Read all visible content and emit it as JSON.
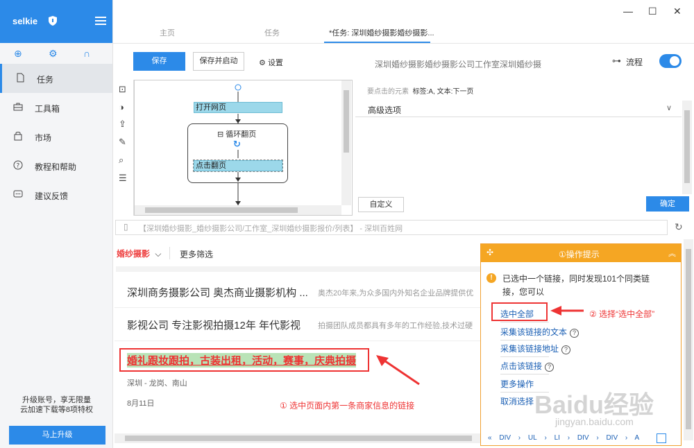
{
  "sidebar": {
    "logo": "selkie",
    "items": [
      {
        "label": "任务",
        "icon": "document-icon"
      },
      {
        "label": "工具箱",
        "icon": "toolbox-icon"
      },
      {
        "label": "市场",
        "icon": "bag-icon"
      },
      {
        "label": "教程和帮助",
        "icon": "help-icon"
      },
      {
        "label": "建议反馈",
        "icon": "feedback-icon"
      }
    ],
    "upgrade_line1": "升级账号，享无限量",
    "upgrade_line2": "云加速下载等8项特权",
    "upgrade_button": "马上升级"
  },
  "tabs": [
    {
      "label": "主页"
    },
    {
      "label": "任务"
    },
    {
      "label": "*任务: 深圳婚纱摄影婚纱摄影..."
    }
  ],
  "toolbar": {
    "save": "保存",
    "save_and_run": "保存并启动",
    "settings": "设置",
    "task_title": "深圳婚纱摄影婚纱摄影公司工作室深圳婚纱摄",
    "flow_label": "流程"
  },
  "workflow": {
    "node_open": "打开网页",
    "loop_title": "循环翻页",
    "node_click": "点击翻页"
  },
  "right_panel": {
    "hint_label": "要点击的元素",
    "hint_value": "标签:A, 文本:下一页",
    "advanced": "高级选项",
    "custom": "自定义",
    "ok": "确定"
  },
  "url": "【深圳婚纱摄影_婚纱摄影公司/工作室_深圳婚纱摄影报价/列表】 - 深圳百姓网",
  "browser": {
    "filter_category": "婚纱摄影",
    "filter_more": "更多筛选",
    "rows": [
      {
        "title": "深圳商务摄影公司 奥杰商业摄影机构 ...",
        "desc": "奥杰20年来,为众多国内外知名企业品牌提供优"
      },
      {
        "title": "影视公司 专注影视拍摄12年 年代影视",
        "desc": "拍摄团队成员都具有多年的工作经验,技术过硬"
      }
    ],
    "highlight_title": "婚礼跟妆跟拍，古装出租，活动，赛事，庆典拍摄",
    "location": "深圳 - 龙岗、南山",
    "date": "8月11日",
    "note": "① 选中页面内第一条商家信息的链接"
  },
  "popup": {
    "title": "①操作提示",
    "message": "已选中一个链接，同时发现101个同类链接，您可以",
    "options": [
      "选中全部",
      "采集该链接的文本",
      "采集该链接地址",
      "点击该链接",
      "更多操作",
      "取消选择"
    ],
    "note": "② 选择“选中全部”",
    "breadcrumb": [
      "«",
      "DIV",
      "›",
      "UL",
      "›",
      "LI",
      "›",
      "DIV",
      "›",
      "DIV",
      "›",
      "A"
    ]
  },
  "watermark": "Baidu经验",
  "watermark_sub": "jingyan.baidu.com",
  "colors": {
    "accent": "#2c8ae8",
    "warning": "#f5a623",
    "annotation": "#e33333"
  }
}
